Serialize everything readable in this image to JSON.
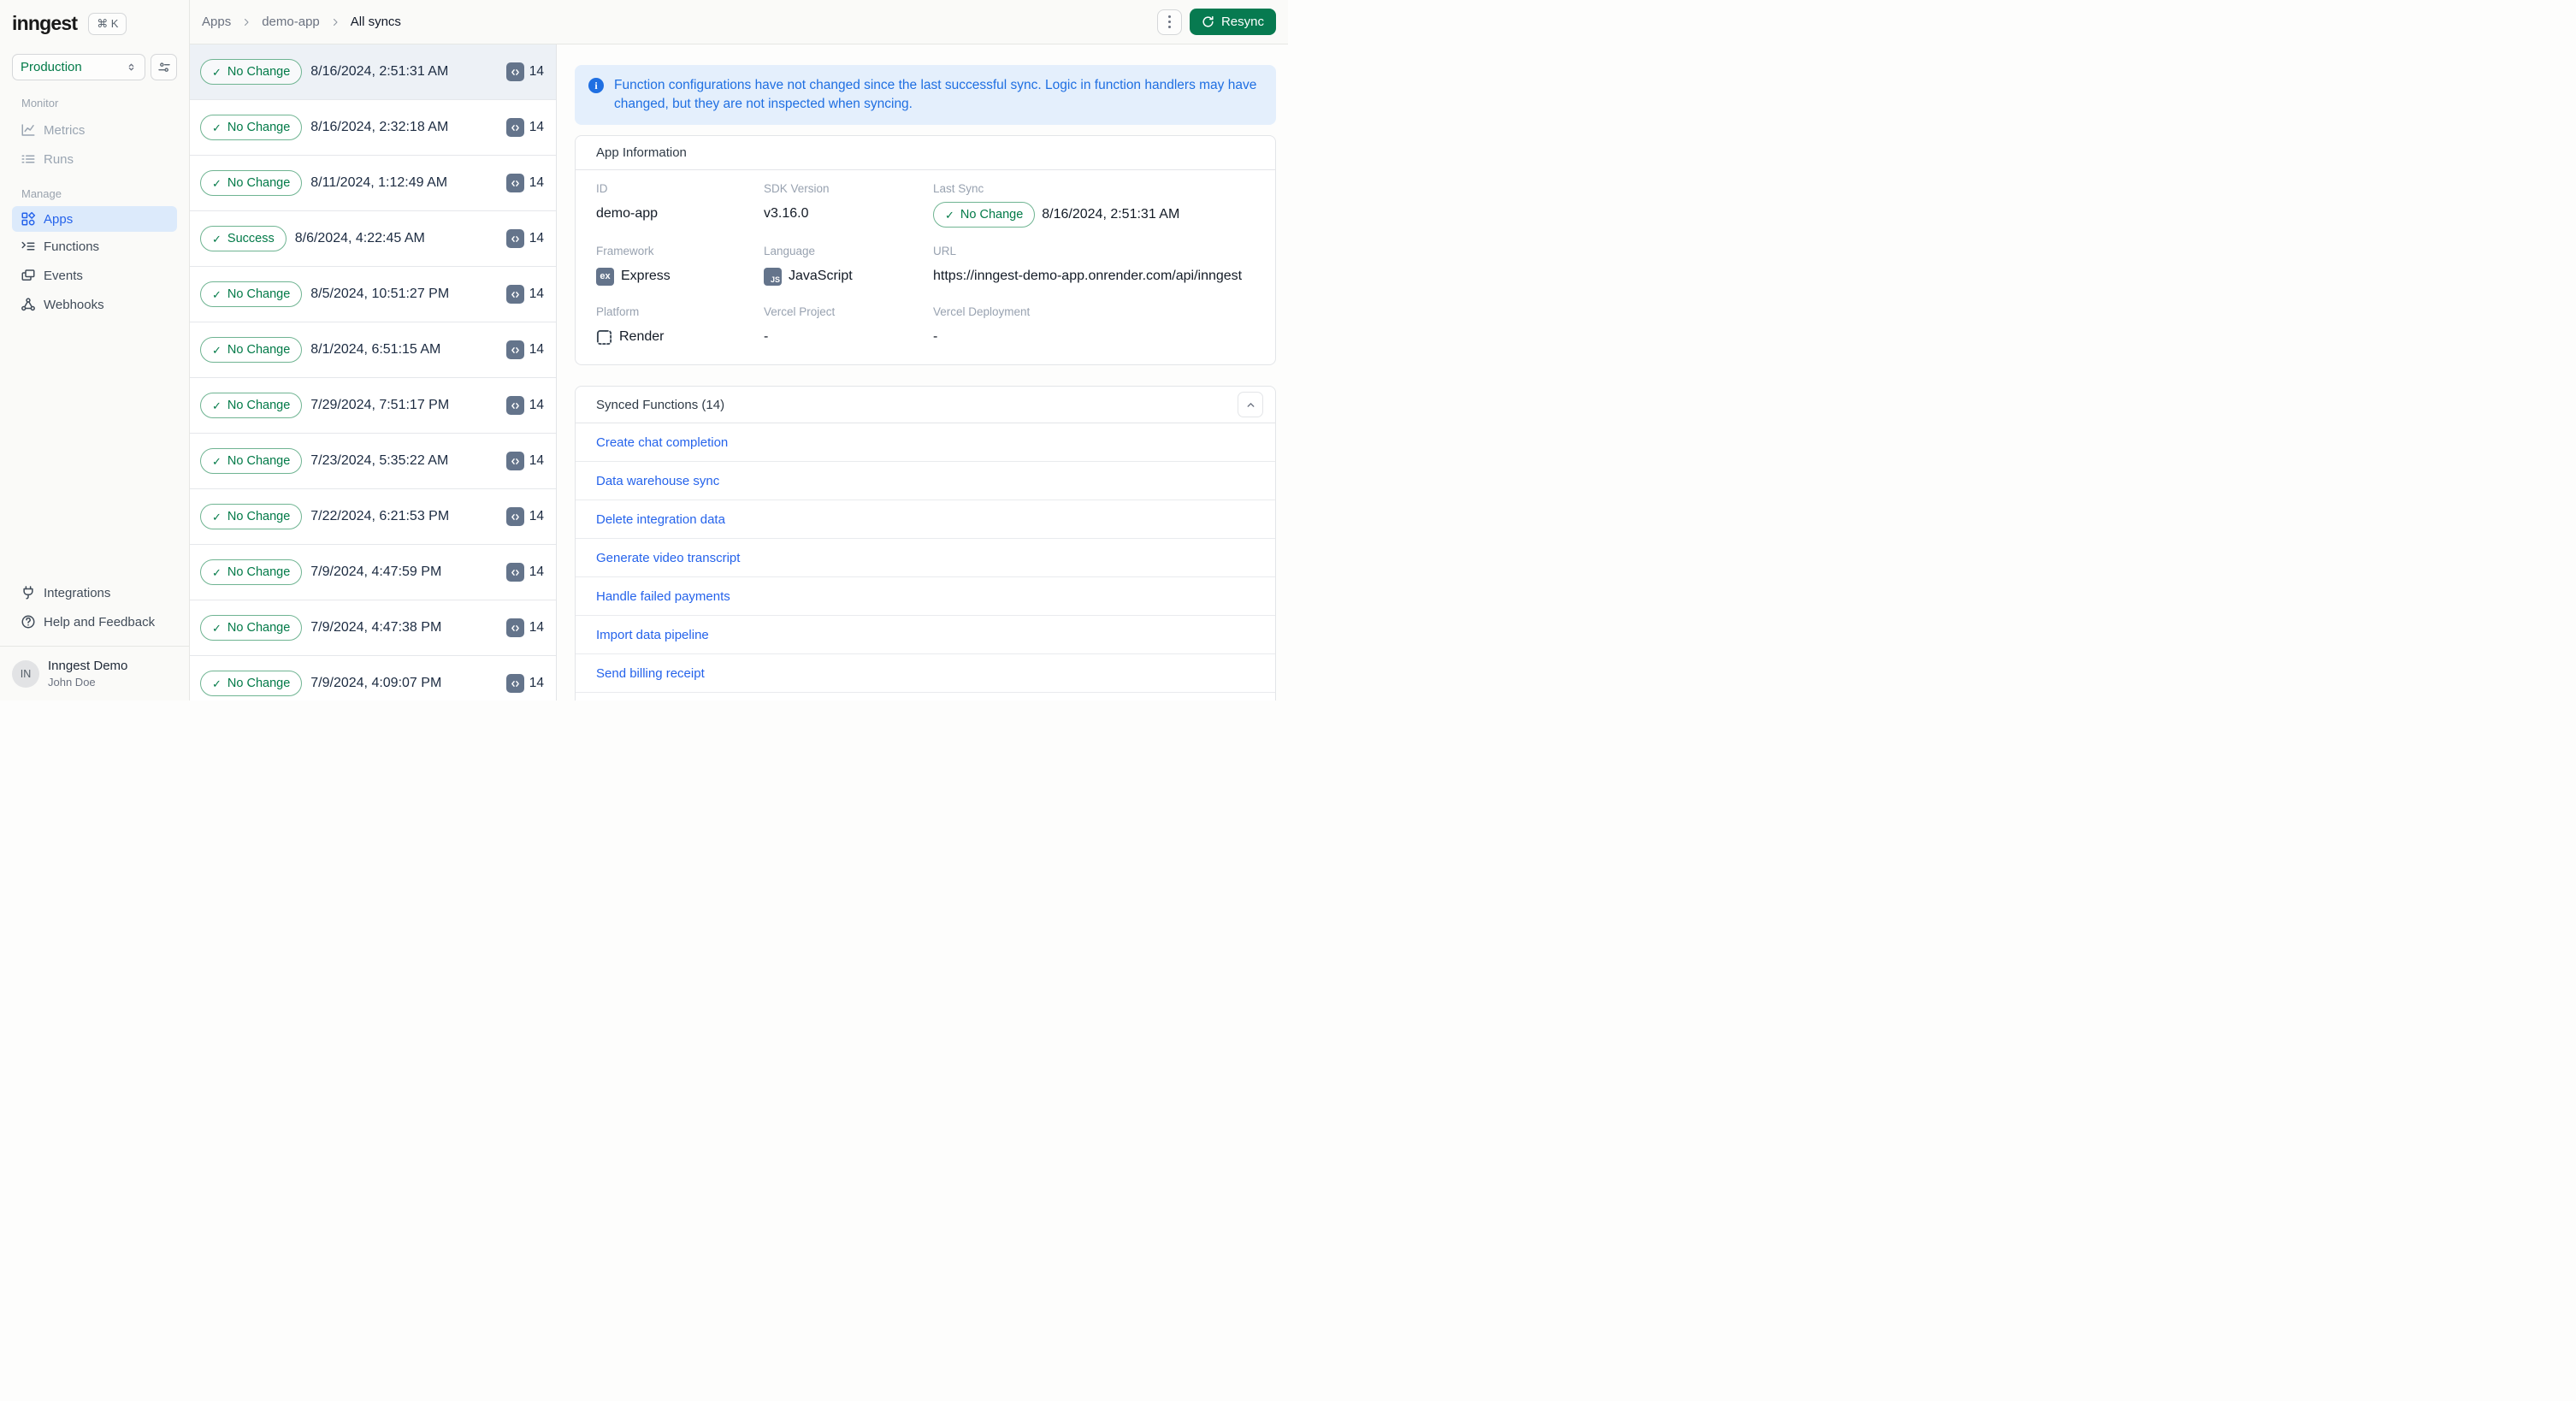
{
  "brand": {
    "logo_text": "inngest",
    "shortcut_keys": "⌘ K"
  },
  "sidebar": {
    "environment": "Production",
    "monitor_label": "Monitor",
    "manage_label": "Manage",
    "metrics": "Metrics",
    "runs": "Runs",
    "apps": "Apps",
    "functions": "Functions",
    "events": "Events",
    "webhooks": "Webhooks",
    "integrations": "Integrations",
    "help": "Help and Feedback",
    "profile": {
      "initials": "IN",
      "org": "Inngest Demo",
      "user": "John Doe"
    }
  },
  "topbar": {
    "breadcrumb": {
      "root": "Apps",
      "app": "demo-app",
      "page": "All syncs"
    },
    "resync": "Resync"
  },
  "sync_list": {
    "rows": [
      {
        "status": "No Change",
        "timestamp": "8/16/2024, 2:51:31 AM",
        "count": "14"
      },
      {
        "status": "No Change",
        "timestamp": "8/16/2024, 2:32:18 AM",
        "count": "14"
      },
      {
        "status": "No Change",
        "timestamp": "8/11/2024, 1:12:49 AM",
        "count": "14"
      },
      {
        "status": "Success",
        "timestamp": "8/6/2024, 4:22:45 AM",
        "count": "14"
      },
      {
        "status": "No Change",
        "timestamp": "8/5/2024, 10:51:27 PM",
        "count": "14"
      },
      {
        "status": "No Change",
        "timestamp": "8/1/2024, 6:51:15 AM",
        "count": "14"
      },
      {
        "status": "No Change",
        "timestamp": "7/29/2024, 7:51:17 PM",
        "count": "14"
      },
      {
        "status": "No Change",
        "timestamp": "7/23/2024, 5:35:22 AM",
        "count": "14"
      },
      {
        "status": "No Change",
        "timestamp": "7/22/2024, 6:21:53 PM",
        "count": "14"
      },
      {
        "status": "No Change",
        "timestamp": "7/9/2024, 4:47:59 PM",
        "count": "14"
      },
      {
        "status": "No Change",
        "timestamp": "7/9/2024, 4:47:38 PM",
        "count": "14"
      },
      {
        "status": "No Change",
        "timestamp": "7/9/2024, 4:09:07 PM",
        "count": "14"
      }
    ]
  },
  "banner": {
    "message": "Function configurations have not changed since the last successful sync. Logic in function handlers may have changed, but they are not inspected when syncing."
  },
  "app_info": {
    "title": "App Information",
    "id_label": "ID",
    "id_value": "demo-app",
    "sdk_label": "SDK Version",
    "sdk_value": "v3.16.0",
    "last_sync_label": "Last Sync",
    "last_sync_badge": "No Change",
    "last_sync_value": "8/16/2024, 2:51:31 AM",
    "framework_label": "Framework",
    "framework_value": "Express",
    "framework_icon_text": "ex",
    "language_label": "Language",
    "language_value": "JavaScript",
    "language_icon_text": "JS",
    "url_label": "URL",
    "url_value": "https://inngest-demo-app.onrender.com/api/inngest",
    "platform_label": "Platform",
    "platform_value": "Render",
    "vercel_project_label": "Vercel Project",
    "vercel_project_value": "-",
    "vercel_deployment_label": "Vercel Deployment",
    "vercel_deployment_value": "-"
  },
  "synced_functions": {
    "title": "Synced Functions (14)",
    "items": [
      "Create chat completion",
      "Data warehouse sync",
      "Delete integration data",
      "Generate video transcript",
      "Handle failed payments",
      "Import data pipeline",
      "Send billing receipt"
    ]
  },
  "colors": {
    "accent_green": "#077A50",
    "badge_green": "#027A48",
    "active_blue": "#2563EB",
    "banner_blue": "#1F6FE2",
    "selected_row_bg": "#EDF1F6"
  }
}
